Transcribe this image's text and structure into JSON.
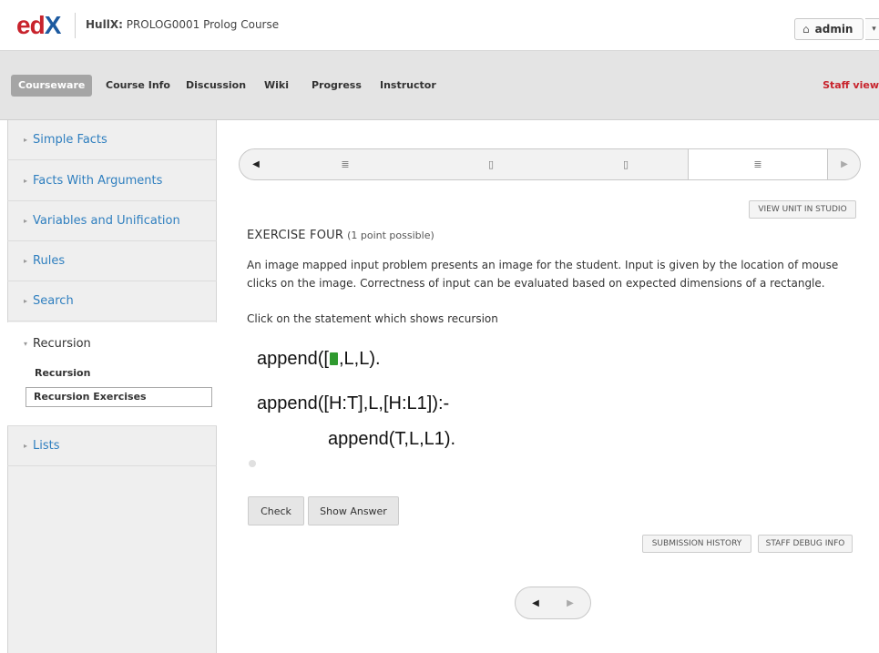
{
  "header": {
    "logo_e": "ed",
    "logo_x": "X",
    "course_org": "HullX:",
    "course_name": "PROLOG0001 Prolog Course",
    "user": "admin",
    "home_glyph": "⌂",
    "dropdown_glyph": "▾"
  },
  "nav": {
    "tabs": [
      "Courseware",
      "Course Info",
      "Discussion",
      "Wiki",
      "Progress",
      "Instructor"
    ],
    "active_tab": "Courseware",
    "staff_view": "Staff view"
  },
  "sidebar": {
    "chapters": [
      {
        "label": "Simple Facts"
      },
      {
        "label": "Facts With Arguments"
      },
      {
        "label": "Variables and Unification"
      },
      {
        "label": "Rules"
      },
      {
        "label": "Search"
      },
      {
        "label": "Recursion",
        "open": true
      },
      {
        "label": "Lists"
      }
    ],
    "subsections": [
      {
        "label": "Recursion"
      },
      {
        "label": "Recursion Exercises",
        "active": true
      }
    ],
    "closed_arrow": "▸",
    "open_arrow": "▾"
  },
  "sequence": {
    "prev_glyph": "◀",
    "next_glyph": "▶",
    "items": [
      {
        "icon": "≣",
        "name": "text-unit-icon"
      },
      {
        "icon": "▯",
        "name": "video-unit-icon"
      },
      {
        "icon": "▯",
        "name": "video-unit-icon"
      },
      {
        "icon": "≣",
        "name": "text-unit-icon",
        "active": true
      }
    ]
  },
  "studio_button": "VIEW UNIT IN STUDIO",
  "problem": {
    "title": "EXERCISE FOUR",
    "points": "(1 point possible)",
    "description": "An image mapped input problem presents an image for the student. Input is given by the location of mouse clicks on the image. Correctness of input can be evaluated based on expected dimensions of a rectangle.",
    "instruction": "Click on the statement which shows recursion",
    "code_line1_pre": "append([",
    "code_line1_post": ",L,L).",
    "code_line2": "append([H:T],L,[H:L1]):-",
    "code_line3": "append(T,L,L1).",
    "mark_color": "#2f9a2f"
  },
  "buttons": {
    "check": "Check",
    "show_answer": "Show Answer",
    "submission_history": "SUBMISSION HISTORY",
    "staff_debug": "STAFF DEBUG INFO"
  },
  "bottom_nav": {
    "prev_glyph": "◀",
    "next_glyph": "▶"
  },
  "colors": {
    "brand_red": "#c8232c",
    "brand_blue": "#1d5aa0",
    "link_blue": "#2f7fbf"
  }
}
